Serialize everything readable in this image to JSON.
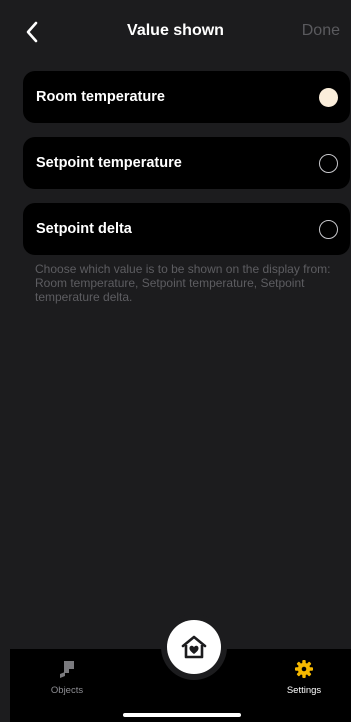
{
  "header": {
    "title": "Value shown",
    "done_label": "Done"
  },
  "options": [
    {
      "label": "Room temperature",
      "selected": true
    },
    {
      "label": "Setpoint temperature",
      "selected": false
    },
    {
      "label": "Setpoint delta",
      "selected": false
    }
  ],
  "description": "Choose which value is to be shown on the display from: Room temperature, Setpoint temperature, Setpoint temperature delta.",
  "nav": {
    "objects_label": "Objects",
    "settings_label": "Settings",
    "active": "settings"
  },
  "icons": {
    "back": "chevron-left-icon",
    "home": "home-heart-icon",
    "objects": "objects-icon",
    "settings": "gear-icon"
  },
  "colors": {
    "background": "#1c1c1e",
    "card": "#000000",
    "selected_radio": "#fbeedb",
    "settings_active": "#f5b800",
    "muted_text": "#5d5d61"
  }
}
